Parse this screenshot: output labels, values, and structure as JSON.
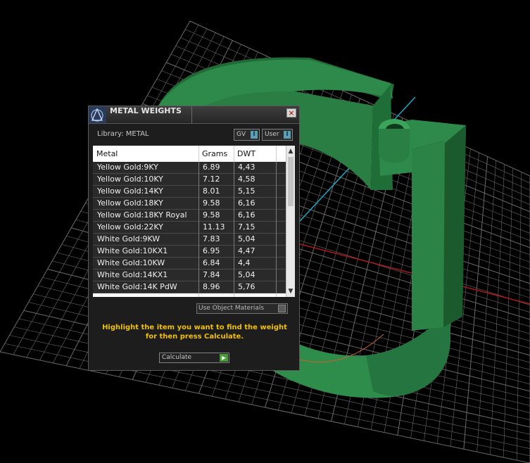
{
  "dialog": {
    "title": "METAL WEIGHTS",
    "close_label": "×",
    "library_label": "Library: METAL",
    "gv_label": "GV",
    "user_label": "User",
    "toggle_knob": "I",
    "columns": [
      "Metal",
      "Grams",
      "DWT"
    ],
    "rows": [
      {
        "metal": "Yellow Gold:9KY",
        "grams": "6.89",
        "dwt": "4,43"
      },
      {
        "metal": "Yellow Gold:10KY",
        "grams": "7.12",
        "dwt": "4,58"
      },
      {
        "metal": "Yellow Gold:14KY",
        "grams": "8.01",
        "dwt": "5,15"
      },
      {
        "metal": "Yellow Gold:18KY",
        "grams": "9.58",
        "dwt": "6,16"
      },
      {
        "metal": "Yellow Gold:18KY Royal",
        "grams": "9.58",
        "dwt": "6,16"
      },
      {
        "metal": "Yellow Gold:22KY",
        "grams": "11.13",
        "dwt": "7,15"
      },
      {
        "metal": "White Gold:9KW",
        "grams": "7.83",
        "dwt": "5,04"
      },
      {
        "metal": "White Gold:10KX1",
        "grams": "6.95",
        "dwt": "4,47"
      },
      {
        "metal": "White Gold:10KW",
        "grams": "6.84",
        "dwt": "4,4"
      },
      {
        "metal": "White Gold:14KX1",
        "grams": "7.84",
        "dwt": "5,04"
      },
      {
        "metal": "White Gold:14K PdW",
        "grams": "8.96",
        "dwt": "5,76"
      }
    ],
    "use_object_materials": "Use Object Materials",
    "instruction": "Highlight the item you want to find the weight for then press Calculate.",
    "calculate_label": "Calculate",
    "calculate_arrow": "▶"
  },
  "scroll": {
    "up": "▲",
    "down": "▼"
  },
  "colors": {
    "model_green": "#2e8a4a",
    "grid_line": "#6a6a6a",
    "x_axis": "#b01818",
    "y_axis": "#1aa8c8",
    "instruction_text": "#f0c000"
  }
}
